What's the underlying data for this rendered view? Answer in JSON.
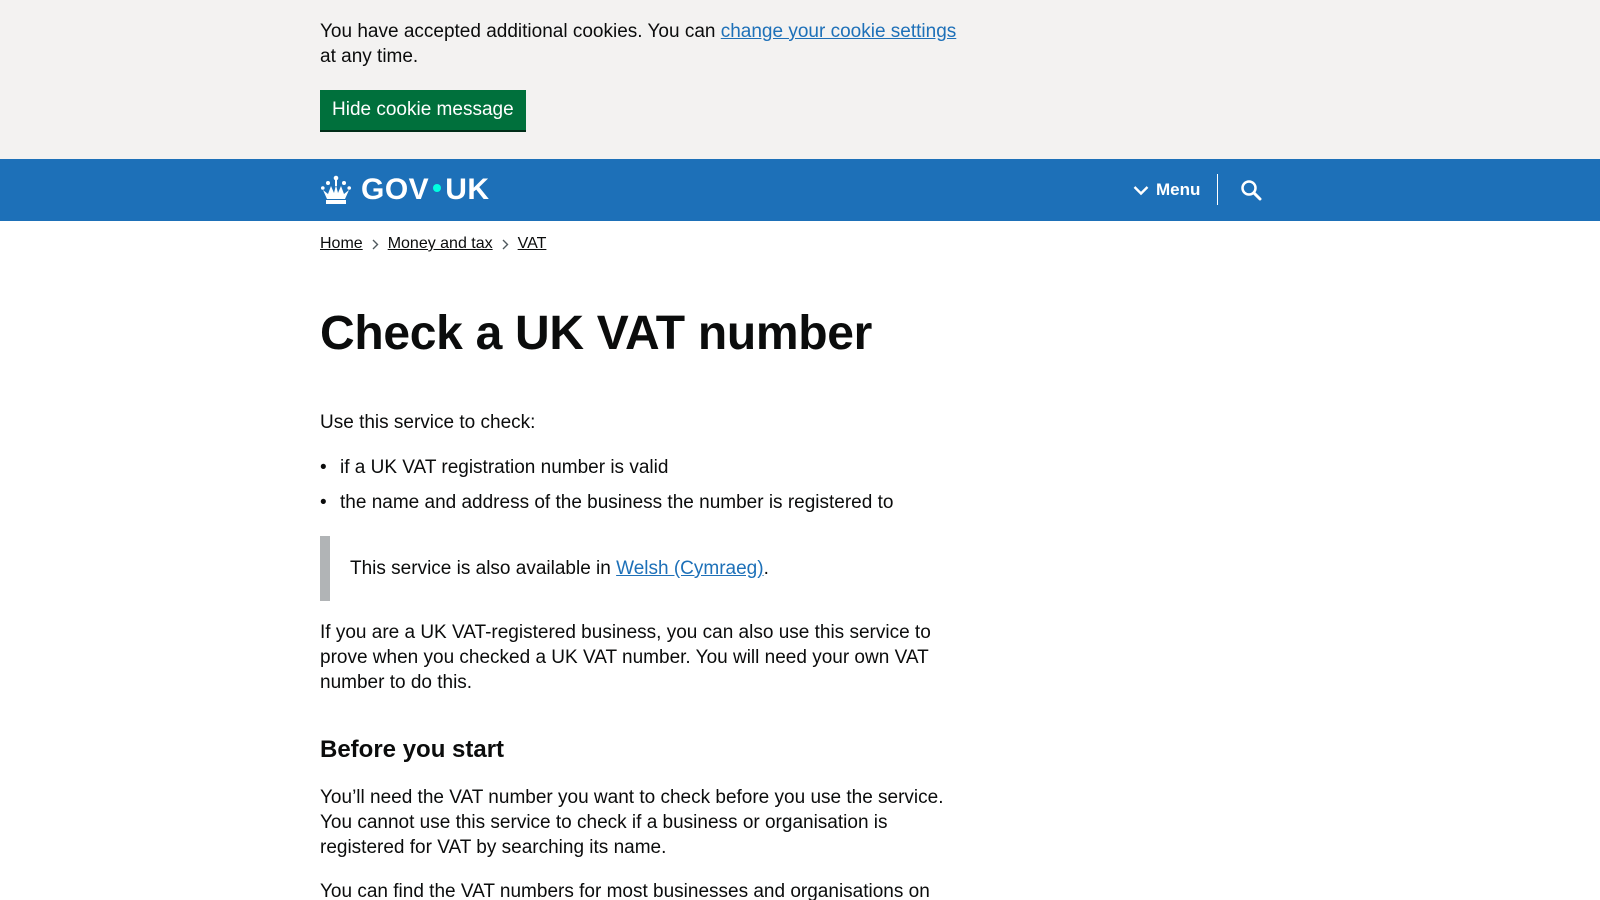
{
  "cookie_banner": {
    "text_before": "You have accepted additional cookies. You can ",
    "link": "change your cookie settings",
    "text_after": " at any time.",
    "hide_button": "Hide cookie message"
  },
  "header": {
    "logo_left": "GOV",
    "logo_right": "UK",
    "menu_label": "Menu",
    "accent_color": "#1d70b8"
  },
  "breadcrumbs": [
    "Home",
    "Money and tax",
    "VAT"
  ],
  "main": {
    "title": "Check a UK VAT number",
    "intro": "Use this service to check:",
    "bullets": [
      "if a UK VAT registration number is valid",
      "the name and address of the business the number is registered to"
    ],
    "inset_before": "This service is also available in ",
    "inset_link": "Welsh (Cymraeg)",
    "inset_after": ".",
    "para_registered": "If you are a UK VAT-registered business, you can also use this service to prove when you checked a UK VAT number. You will need your own VAT number to do this.",
    "heading_before": "Before you start",
    "para_need": "You’ll need the VAT number you want to check before you use the service. You cannot use this service to check if a business or organisation is registered for VAT by searching its name.",
    "para_find": "You can find the VAT numbers for most businesses and organisations on their"
  }
}
